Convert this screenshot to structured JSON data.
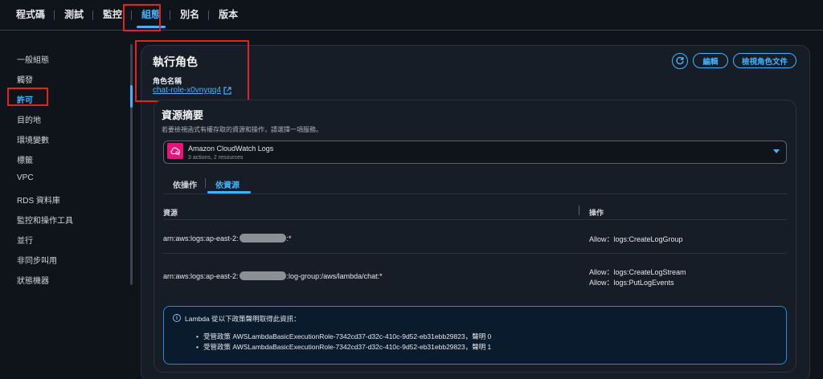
{
  "tabs": [
    {
      "label": "程式碼",
      "active": false
    },
    {
      "label": "測試",
      "active": false
    },
    {
      "label": "監控",
      "active": false
    },
    {
      "label": "組態",
      "active": true
    },
    {
      "label": "別名",
      "active": false
    },
    {
      "label": "版本",
      "active": false
    }
  ],
  "sidebar": {
    "items": [
      {
        "label": "一般組態",
        "active": false
      },
      {
        "label": "觸發",
        "active": false
      },
      {
        "label": "許可",
        "active": true
      },
      {
        "label": "目的地",
        "active": false
      },
      {
        "label": "環境變數",
        "active": false
      },
      {
        "label": "標籤",
        "active": false
      },
      {
        "label": "VPC",
        "active": false
      },
      {
        "label": "RDS 資料庫",
        "active": false
      },
      {
        "label": "監控和操作工具",
        "active": false
      },
      {
        "label": "並行",
        "active": false
      },
      {
        "label": "非同步叫用",
        "active": false
      },
      {
        "label": "狀態機器",
        "active": false
      }
    ]
  },
  "exec_role": {
    "title": "執行角色",
    "role_name_label": "角色名稱",
    "role_name": "chat-role-x0vnygq4",
    "edit_button": "編輯",
    "view_doc_button": "檢視角色文件"
  },
  "resource_summary": {
    "title": "資源摘要",
    "description": "若要檢視函式有權存取的資源和操作，請選擇一項服務。",
    "service": {
      "name": "Amazon CloudWatch Logs",
      "detail": "3 actions, 2 resources"
    },
    "tabs": {
      "by_action": "依操作",
      "by_resource": "依資源"
    },
    "table": {
      "headers": {
        "resource": "資源",
        "action": "操作"
      },
      "rows": [
        {
          "resource_prefix": "arn:aws:logs:ap-east-2:",
          "resource_suffix": ":*",
          "actions": [
            "Allow：logs:CreateLogGroup"
          ]
        },
        {
          "resource_prefix": "arn:aws:logs:ap-east-2:",
          "resource_suffix": ":log-group:/aws/lambda/chat:*",
          "actions": [
            "Allow：logs:CreateLogStream",
            "Allow：logs:PutLogEvents"
          ]
        }
      ]
    },
    "info": {
      "text": "Lambda 從以下政策聲明取得此資訊：",
      "items": [
        "受管政策 AWSLambdaBasicExecutionRole-7342cd37-d32c-410c-9d52-eb31ebb29823，聲明 0",
        "受管政策 AWSLambdaBasicExecutionRole-7342cd37-d32c-410c-9d52-eb31ebb29823，聲明 1"
      ]
    }
  },
  "colors": {
    "accent": "#42b4ff",
    "highlight": "#e02424",
    "service_icon": "#e7157b"
  }
}
